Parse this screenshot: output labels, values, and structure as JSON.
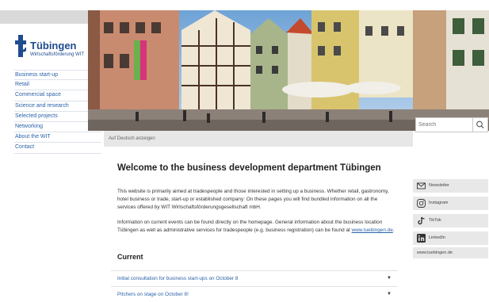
{
  "logo": {
    "name": "Tübingen",
    "subtitle": "Wirtschaftsförderung WIT"
  },
  "nav": [
    "Business start-up",
    "Retail",
    "Commercial space",
    "Science and research",
    "Selected projects",
    "Networking",
    "About the WIT",
    "Contact"
  ],
  "hero": {
    "caption": "Auf Deutsch anzeigen"
  },
  "search": {
    "placeholder": "Search"
  },
  "main": {
    "heading": "Welcome to the business development department Tübingen",
    "p1": "This website is primarily aimed at tradespeople and those interested in setting up a business. Whether retail, gastronomy, hotel business or trade, start-up or established company: On these pages you will find bundled information on all the services offered by WIT Wirtschaftsförderungsgesellschaft mbH.",
    "p2": "Information on current events can be found directly on the homepage. General information about the business location Tübingen as well as administrative services for tradespeople (e.g. business registration) can be found at ",
    "p2_link": "www.tuebingen.de",
    "p2_end": ".",
    "current": "Current"
  },
  "accordion": [
    "Initial consultation for business start-ups on October 8",
    "Pitchers on stage on October 8!"
  ],
  "social": [
    "Newsletter",
    "Instagram",
    "TikTok",
    "LinkedIn"
  ],
  "external_link": "www.tuebingen.de",
  "colors": {
    "brand": "#1f4b8f",
    "link": "#2b63a8"
  }
}
